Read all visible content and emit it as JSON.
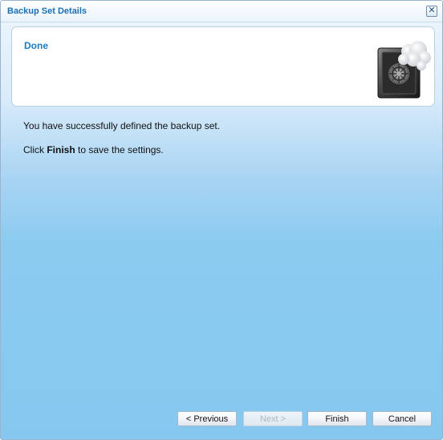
{
  "dialog": {
    "title": "Backup Set Details",
    "close_glyph": "✕"
  },
  "header": {
    "title": "Done",
    "icon": "cloud-safe-icon"
  },
  "content": {
    "line1": "You have successfully defined the backup set.",
    "line2_prefix": "Click ",
    "line2_bold": "Finish",
    "line2_suffix": " to save the settings."
  },
  "buttons": {
    "previous": "< Previous",
    "next": "Next >",
    "finish": "Finish",
    "cancel": "Cancel"
  },
  "colors": {
    "title_blue": "#1a6fb5",
    "header_title_blue": "#1a7cc0",
    "background_blue": "#85c8ef"
  }
}
